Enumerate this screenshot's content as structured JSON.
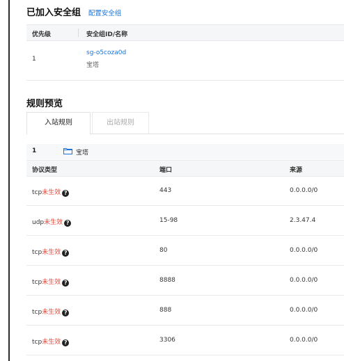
{
  "security_group": {
    "title": "已加入安全组",
    "config_link": "配置安全组",
    "table": {
      "headers": {
        "priority": "优先级",
        "id_name": "安全组ID/名称"
      },
      "rows": [
        {
          "priority": "1",
          "id": "sg-o5coza0d",
          "name": "宝塔"
        }
      ]
    }
  },
  "rule_preview": {
    "title": "规则预览",
    "tabs": [
      {
        "label": "入站规则",
        "active": true
      },
      {
        "label": "出站规则",
        "active": false
      }
    ],
    "group": {
      "index": "1",
      "icon": "folder-icon",
      "name": "宝塔"
    },
    "headers": {
      "protocol": "协议类型",
      "port": "端口",
      "source": "来源"
    },
    "rules": [
      {
        "protocol": "tcp",
        "status": "未生效",
        "port": "443",
        "source": "0.0.0.0/0"
      },
      {
        "protocol": "udp",
        "status": "未生效",
        "port": "15-98",
        "source": "2.3.47.4"
      },
      {
        "protocol": "tcp",
        "status": "未生效",
        "port": "80",
        "source": "0.0.0.0/0"
      },
      {
        "protocol": "tcp",
        "status": "未生效",
        "port": "8888",
        "source": "0.0.0.0/0"
      },
      {
        "protocol": "tcp",
        "status": "未生效",
        "port": "888",
        "source": "0.0.0.0/0"
      },
      {
        "protocol": "tcp",
        "status": "未生效",
        "port": "3306",
        "source": "0.0.0.0/0"
      }
    ]
  },
  "colors": {
    "link": "#1a73d9",
    "warning": "#e34a3c",
    "header_bg": "#f5f6f8",
    "border": "#e7e9ec"
  }
}
